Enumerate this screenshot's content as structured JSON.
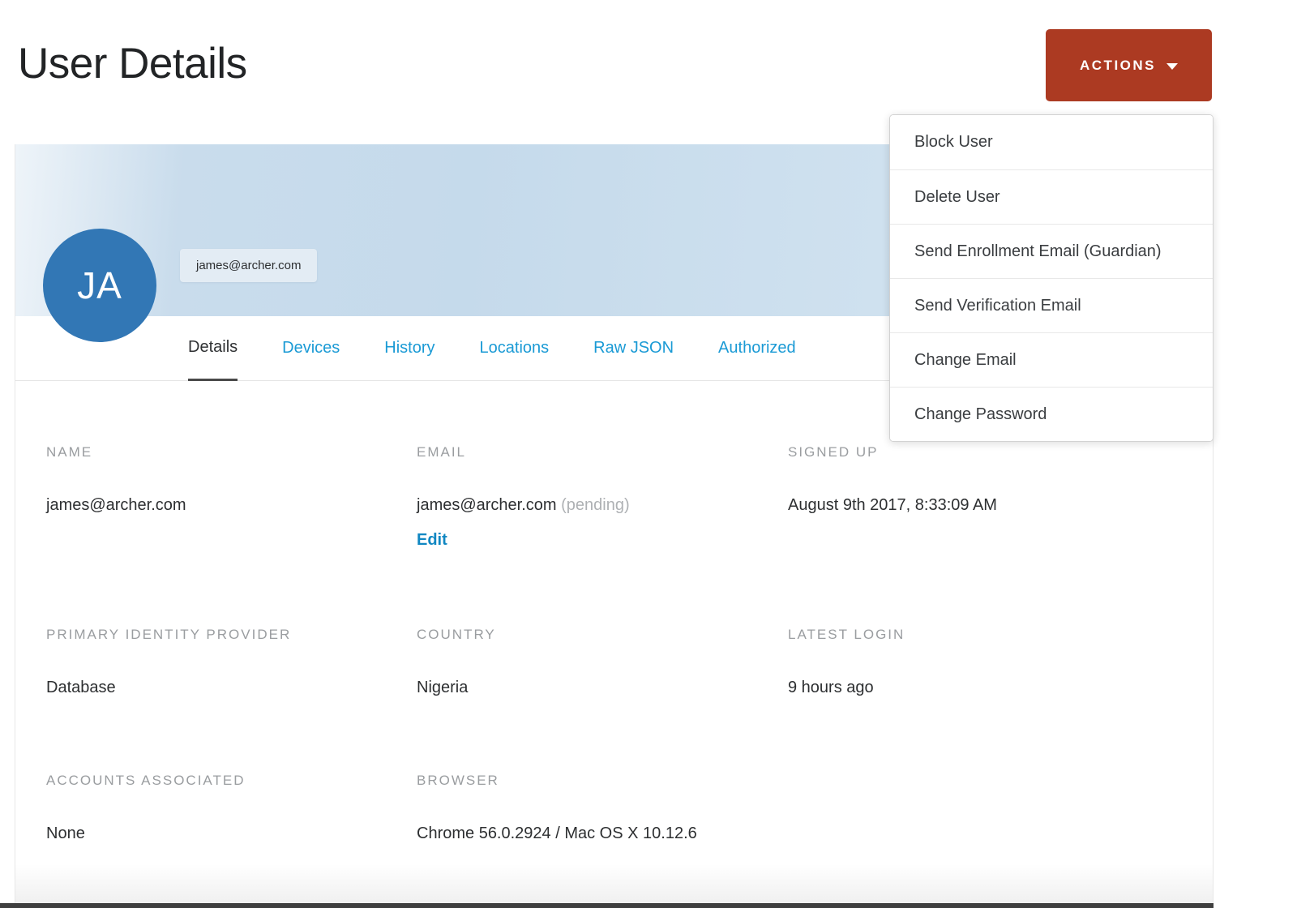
{
  "header": {
    "title": "User Details"
  },
  "actions": {
    "label": "ACTIONS"
  },
  "menu": {
    "items": [
      "Block User",
      "Delete User",
      "Send Enrollment Email (Guardian)",
      "Send Verification Email",
      "Change Email",
      "Change Password"
    ]
  },
  "profile": {
    "initials": "JA",
    "email": "james@archer.com"
  },
  "tabs": {
    "items": [
      {
        "label": "Details",
        "active": true
      },
      {
        "label": "Devices",
        "active": false
      },
      {
        "label": "History",
        "active": false
      },
      {
        "label": "Locations",
        "active": false
      },
      {
        "label": "Raw JSON",
        "active": false
      },
      {
        "label": "Authorized",
        "active": false
      }
    ]
  },
  "fields": {
    "name": {
      "label": "NAME",
      "value": "james@archer.com"
    },
    "email": {
      "label": "EMAIL",
      "value": "james@archer.com",
      "status": "(pending)",
      "action": "Edit"
    },
    "signed_up": {
      "label": "SIGNED UP",
      "value": "August 9th 2017, 8:33:09 AM"
    },
    "primary_idp": {
      "label": "PRIMARY IDENTITY PROVIDER",
      "value": "Database"
    },
    "country": {
      "label": "COUNTRY",
      "value": "Nigeria"
    },
    "latest_login": {
      "label": "LATEST LOGIN",
      "value": "9 hours ago"
    },
    "accounts": {
      "label": "ACCOUNTS ASSOCIATED",
      "value": "None"
    },
    "browser": {
      "label": "BROWSER",
      "value": "Chrome 56.0.2924 / Mac OS X 10.12.6"
    }
  },
  "colors": {
    "accent_red": "#ac3a22",
    "link_blue": "#1a9ad5",
    "avatar_blue": "#3277b5",
    "banner_blue": "#c9dcec",
    "label_gray": "#9a9da0"
  }
}
